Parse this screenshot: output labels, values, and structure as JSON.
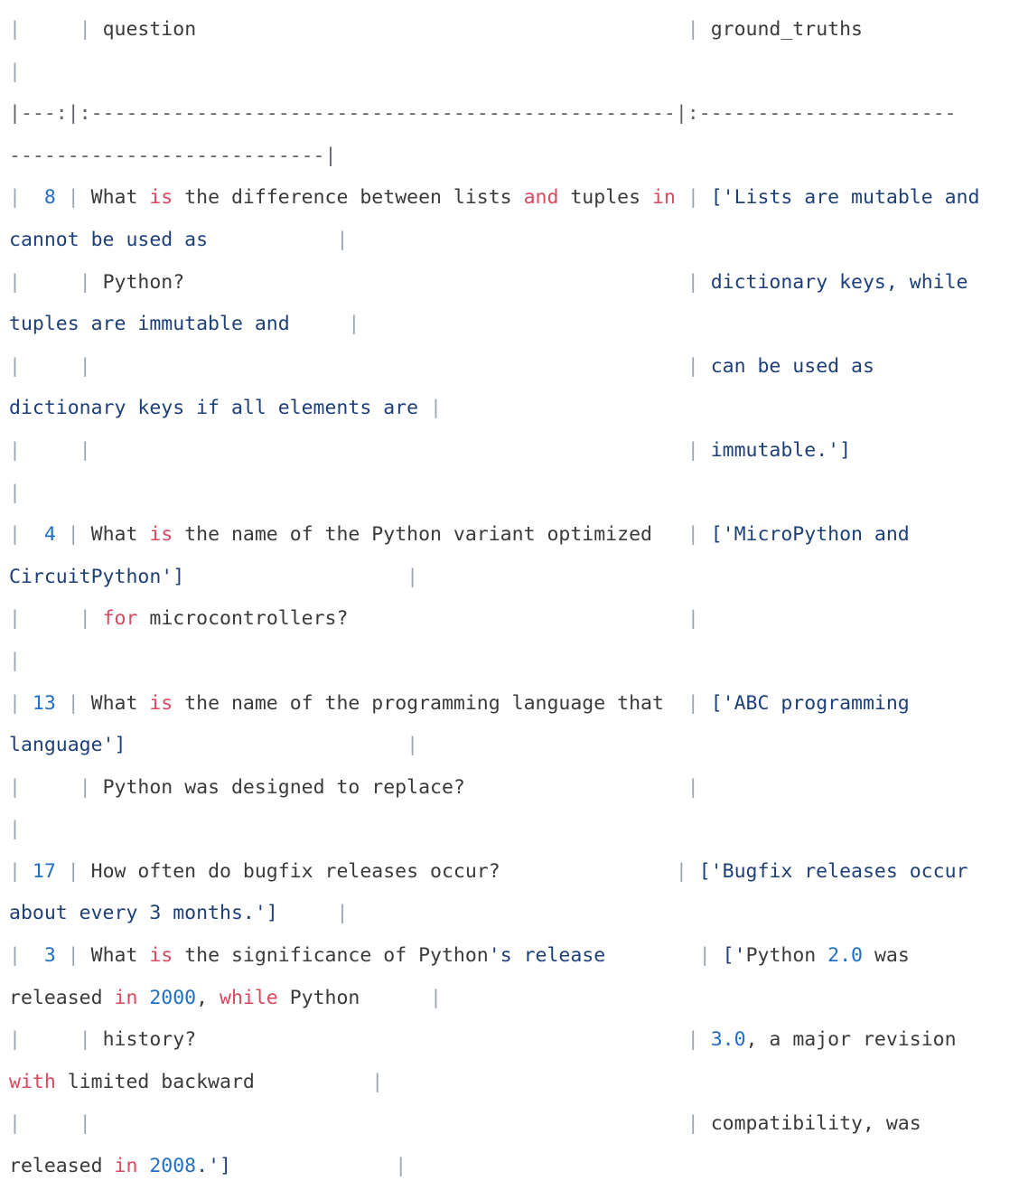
{
  "colors": {
    "pipe": "#9aa6b3",
    "keyword": "#d9485f",
    "number": "#1f6fc9",
    "string": "#1d3f7a",
    "text": "#3a3a3a",
    "background": "#ffffff"
  },
  "lines": [
    [
      [
        "p",
        "|"
      ],
      [
        "t",
        "     "
      ],
      [
        "p",
        "|"
      ],
      [
        "t",
        " question                                          "
      ],
      [
        "p",
        "|"
      ],
      [
        "t",
        " ground_truths"
      ]
    ],
    [
      [
        "p",
        "|"
      ]
    ],
    [
      [
        "d",
        "|---:|:--------------------------------------------------|:----------------------"
      ]
    ],
    [
      [
        "d",
        "---------------------------|"
      ]
    ],
    [
      [
        "p",
        "|"
      ],
      [
        "n",
        "  8 "
      ],
      [
        "p",
        "|"
      ],
      [
        "t",
        " What "
      ],
      [
        "k",
        "is"
      ],
      [
        "t",
        " the difference between lists "
      ],
      [
        "k",
        "and"
      ],
      [
        "t",
        " tuples "
      ],
      [
        "k",
        "in"
      ],
      [
        "t",
        " "
      ],
      [
        "p",
        "|"
      ],
      [
        "s",
        " ['Lists are mutable and"
      ]
    ],
    [
      [
        "s",
        "cannot be used as"
      ],
      [
        "t",
        "           "
      ],
      [
        "p",
        "|"
      ]
    ],
    [
      [
        "p",
        "|"
      ],
      [
        "t",
        "     "
      ],
      [
        "p",
        "|"
      ],
      [
        "t",
        " Python?                                           "
      ],
      [
        "p",
        "|"
      ],
      [
        "s",
        " dictionary keys, while"
      ]
    ],
    [
      [
        "s",
        "tuples are immutable and"
      ],
      [
        "t",
        "     "
      ],
      [
        "p",
        "|"
      ]
    ],
    [
      [
        "p",
        "|"
      ],
      [
        "t",
        "     "
      ],
      [
        "p",
        "|"
      ],
      [
        "t",
        "                                                   "
      ],
      [
        "p",
        "|"
      ],
      [
        "s",
        " can be used as"
      ]
    ],
    [
      [
        "s",
        "dictionary keys if all elements are"
      ],
      [
        "t",
        " "
      ],
      [
        "p",
        "|"
      ]
    ],
    [
      [
        "p",
        "|"
      ],
      [
        "t",
        "     "
      ],
      [
        "p",
        "|"
      ],
      [
        "t",
        "                                                   "
      ],
      [
        "p",
        "|"
      ],
      [
        "s",
        " immutable.']"
      ]
    ],
    [
      [
        "p",
        "|"
      ]
    ],
    [
      [
        "p",
        "|"
      ],
      [
        "n",
        "  4 "
      ],
      [
        "p",
        "|"
      ],
      [
        "t",
        " What "
      ],
      [
        "k",
        "is"
      ],
      [
        "t",
        " the name of the Python variant optimized   "
      ],
      [
        "p",
        "|"
      ],
      [
        "s",
        " ['MicroPython and"
      ]
    ],
    [
      [
        "s",
        "CircuitPython']"
      ],
      [
        "t",
        "                   "
      ],
      [
        "p",
        "|"
      ]
    ],
    [
      [
        "p",
        "|"
      ],
      [
        "t",
        "     "
      ],
      [
        "p",
        "|"
      ],
      [
        "t",
        " "
      ],
      [
        "k",
        "for"
      ],
      [
        "t",
        " microcontrollers?                             "
      ],
      [
        "p",
        "|"
      ]
    ],
    [
      [
        "p",
        "|"
      ]
    ],
    [
      [
        "p",
        "|"
      ],
      [
        "n",
        " 13 "
      ],
      [
        "p",
        "|"
      ],
      [
        "t",
        " What "
      ],
      [
        "k",
        "is"
      ],
      [
        "t",
        " the name of the programming language that  "
      ],
      [
        "p",
        "|"
      ],
      [
        "s",
        " ['ABC programming"
      ]
    ],
    [
      [
        "s",
        "language']"
      ],
      [
        "t",
        "                        "
      ],
      [
        "p",
        "|"
      ]
    ],
    [
      [
        "p",
        "|"
      ],
      [
        "t",
        "     "
      ],
      [
        "p",
        "|"
      ],
      [
        "t",
        " Python was designed to replace?                   "
      ],
      [
        "p",
        "|"
      ]
    ],
    [
      [
        "p",
        "|"
      ]
    ],
    [
      [
        "p",
        "|"
      ],
      [
        "n",
        " 17 "
      ],
      [
        "p",
        "|"
      ],
      [
        "t",
        " How often do bugfix releases occur?               "
      ],
      [
        "p",
        "|"
      ],
      [
        "s",
        " ['Bugfix releases occur"
      ]
    ],
    [
      [
        "s",
        "about every 3 months.']"
      ],
      [
        "t",
        "     "
      ],
      [
        "p",
        "|"
      ]
    ],
    [
      [
        "p",
        "|"
      ],
      [
        "n",
        "  3 "
      ],
      [
        "p",
        "|"
      ],
      [
        "t",
        " What "
      ],
      [
        "k",
        "is"
      ],
      [
        "t",
        " the significance of Python"
      ],
      [
        "s",
        "'s release"
      ],
      [
        "t",
        "        "
      ],
      [
        "p",
        "|"
      ],
      [
        "s",
        " ['"
      ],
      [
        "t",
        "Python "
      ],
      [
        "n",
        "2.0"
      ],
      [
        "t",
        " was"
      ]
    ],
    [
      [
        "t",
        "released "
      ],
      [
        "k",
        "in"
      ],
      [
        "t",
        " "
      ],
      [
        "n",
        "2000"
      ],
      [
        "t",
        ", "
      ],
      [
        "k",
        "while"
      ],
      [
        "t",
        " Python      "
      ],
      [
        "p",
        "|"
      ]
    ],
    [
      [
        "p",
        "|"
      ],
      [
        "t",
        "     "
      ],
      [
        "p",
        "|"
      ],
      [
        "t",
        " history?                                          "
      ],
      [
        "p",
        "|"
      ],
      [
        "t",
        " "
      ],
      [
        "n",
        "3.0"
      ],
      [
        "t",
        ", a major revision"
      ]
    ],
    [
      [
        "k",
        "with"
      ],
      [
        "t",
        " limited backward          "
      ],
      [
        "p",
        "|"
      ]
    ],
    [
      [
        "p",
        "|"
      ],
      [
        "t",
        "     "
      ],
      [
        "p",
        "|"
      ],
      [
        "t",
        "                                                   "
      ],
      [
        "p",
        "|"
      ],
      [
        "t",
        " compatibility, was"
      ]
    ],
    [
      [
        "t",
        "released "
      ],
      [
        "k",
        "in"
      ],
      [
        "t",
        " "
      ],
      [
        "n",
        "2008"
      ],
      [
        "s",
        ".']"
      ],
      [
        "t",
        "              "
      ],
      [
        "p",
        "|"
      ]
    ]
  ]
}
